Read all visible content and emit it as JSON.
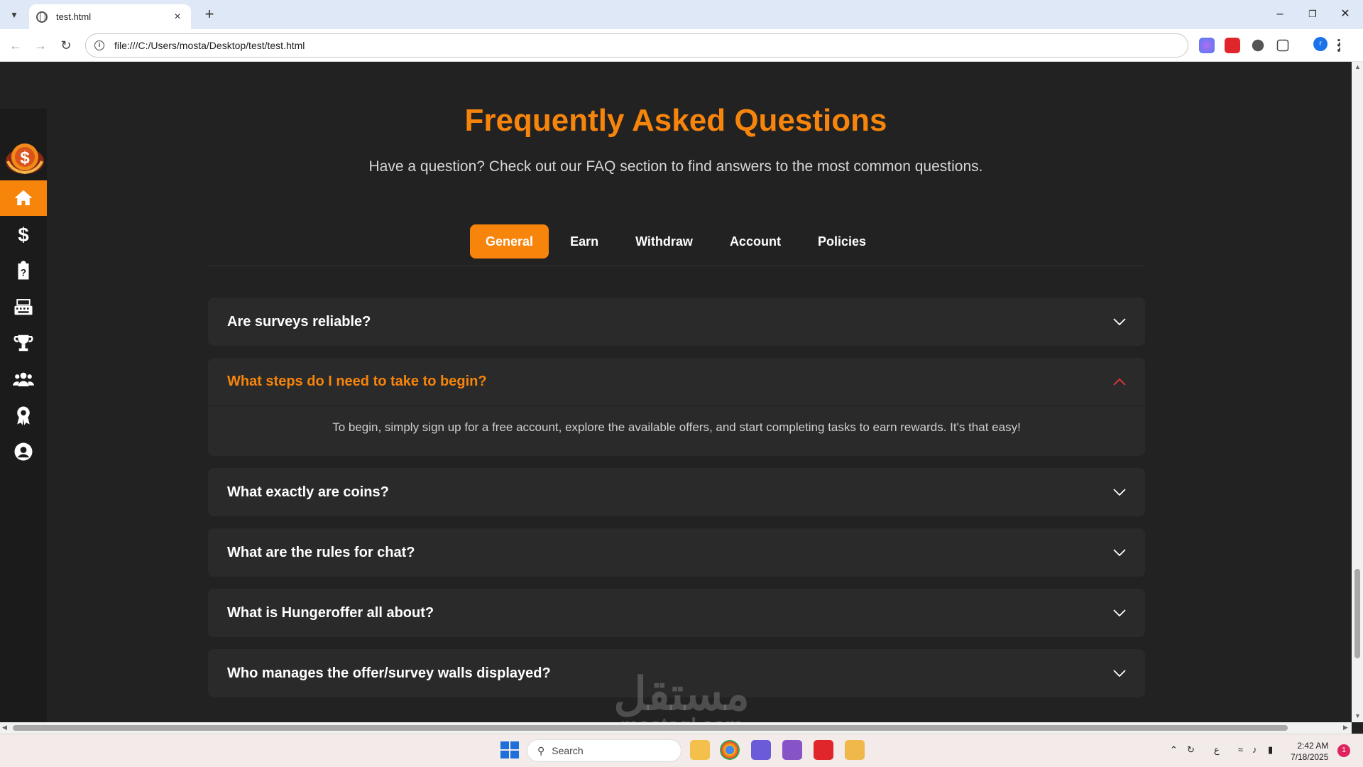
{
  "browser": {
    "tab_title": "test.html",
    "url": "file:///C:/Users/mosta/Desktop/test/test.html",
    "profile_initial": "r"
  },
  "faq": {
    "title": "Frequently Asked Questions",
    "subtitle": "Have a question? Check out our FAQ section to find answers to the most common questions.",
    "tabs": [
      "General",
      "Earn",
      "Withdraw",
      "Account",
      "Policies"
    ],
    "active_tab": "General",
    "items": [
      {
        "question": "Are surveys reliable?",
        "open": false
      },
      {
        "question": "What steps do I need to take to begin?",
        "open": true,
        "answer": "To begin, simply sign up for a free account, explore the available offers, and start completing tasks to earn rewards. It's that easy!"
      },
      {
        "question": "What exactly are coins?",
        "open": false
      },
      {
        "question": "What are the rules for chat?",
        "open": false
      },
      {
        "question": "What is Hungeroffer all about?",
        "open": false
      },
      {
        "question": "Who manages the offer/survey walls displayed?",
        "open": false
      }
    ]
  },
  "sidebar": {
    "items": [
      "home-icon",
      "dollar-icon",
      "clipboard-question-icon",
      "keyboard-icon",
      "trophy-icon",
      "users-icon",
      "award-icon",
      "user-circle-icon"
    ],
    "active": "home-icon"
  },
  "watermark": {
    "arabic": "مستقل",
    "latin": "mostaql.com"
  },
  "taskbar": {
    "search_placeholder": "Search",
    "time": "2:42 AM",
    "date": "7/18/2025",
    "notification_count": "1",
    "lang": "ع"
  },
  "colors": {
    "accent": "#f7840b",
    "bg": "#222222",
    "card": "#2a2a2a",
    "sidebar": "#1b1b1b"
  }
}
